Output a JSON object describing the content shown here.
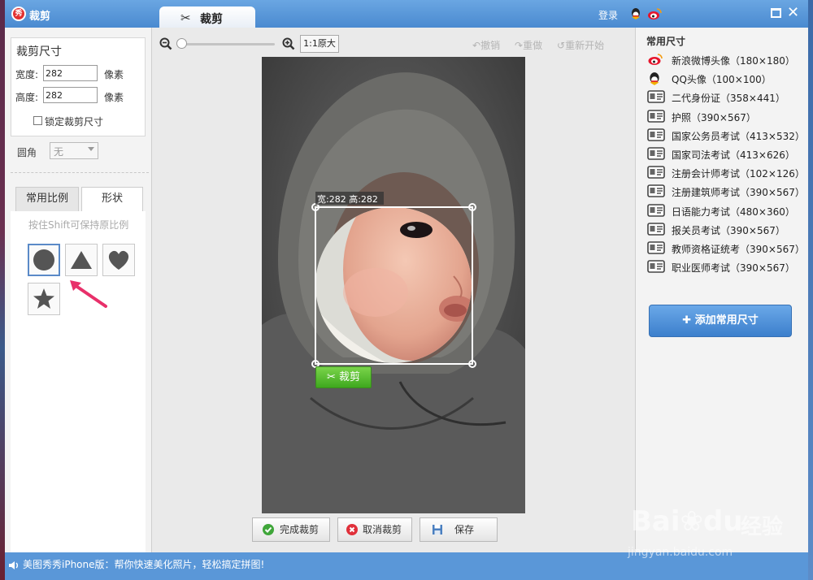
{
  "app": {
    "logo": "秀",
    "title": "裁剪",
    "active_tab": "裁剪",
    "login": "登录"
  },
  "crop_size": {
    "title": "裁剪尺寸",
    "width_label": "宽度:",
    "width_value": "282",
    "width_unit": "像素",
    "height_label": "高度:",
    "height_value": "282",
    "height_unit": "像素",
    "lock_label": "锁定裁剪尺寸",
    "lock_checked": false
  },
  "corner": {
    "label": "圆角",
    "value": "无"
  },
  "shape_tabs": [
    {
      "label": "常用比例",
      "active": false
    },
    {
      "label": "形状",
      "active": true
    }
  ],
  "shape_hint": "按住Shift可保持原比例",
  "shapes": [
    "circle",
    "triangle",
    "heart",
    "star"
  ],
  "toolbar": {
    "original_size": "1:1原大",
    "undo": "撤销",
    "redo": "重做",
    "restart": "重新开始"
  },
  "crop_overlay": {
    "dimension_label": "宽:282 高:282",
    "crop_button": "裁剪"
  },
  "bottom_buttons": {
    "finish": "完成裁剪",
    "cancel": "取消裁剪",
    "save": "保存"
  },
  "presets": {
    "title": "常用尺寸",
    "items": [
      {
        "icon": "weibo-icon",
        "label": "新浪微博头像（180×180）"
      },
      {
        "icon": "qq-icon",
        "label": "QQ头像（100×100）"
      },
      {
        "icon": "id-card-icon",
        "label": "二代身份证（358×441）"
      },
      {
        "icon": "id-card-icon",
        "label": "护照（390×567）"
      },
      {
        "icon": "id-card-icon",
        "label": "国家公务员考试（413×532）"
      },
      {
        "icon": "id-card-icon",
        "label": "国家司法考试（413×626）"
      },
      {
        "icon": "id-card-icon",
        "label": "注册会计师考试（102×126）"
      },
      {
        "icon": "id-card-icon",
        "label": "注册建筑师考试（390×567）"
      },
      {
        "icon": "id-card-icon",
        "label": "日语能力考试（480×360）"
      },
      {
        "icon": "id-card-icon",
        "label": "报关员考试（390×567）"
      },
      {
        "icon": "id-card-icon",
        "label": "教师资格证统考（390×567）"
      },
      {
        "icon": "id-card-icon",
        "label": "职业医师考试（390×567）"
      }
    ],
    "add_button": "添加常用尺寸"
  },
  "status_bar": {
    "text": "美图秀秀iPhone版：帮你快速美化照片，轻松搞定拼图!"
  },
  "watermark": {
    "brand": "Bai",
    "brand2": "du",
    "cn": "经验",
    "url": "jingyan.baidu.com"
  },
  "colors": {
    "window_blue": "#4f8fd0",
    "accent_button": "#3c7fcc",
    "crop_green": "#4fb82a",
    "arrow_pink": "#e8306a"
  }
}
